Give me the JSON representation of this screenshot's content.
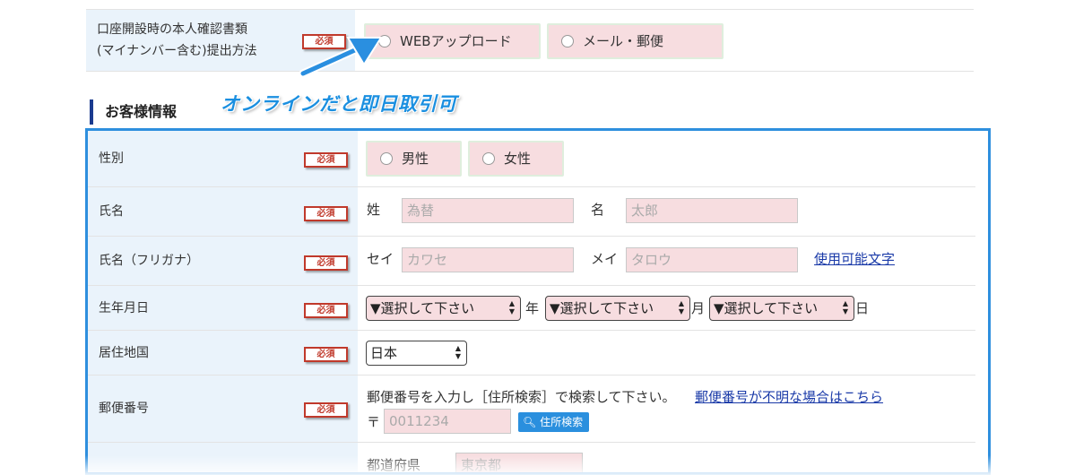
{
  "top_section": {
    "label_line1": "口座開設時の本人確認書類",
    "label_line2": "(マイナンバー含む)提出方法",
    "required": "必須",
    "options": [
      "WEBアップロード",
      "メール・郵便"
    ]
  },
  "customer_section": {
    "heading": "お客様情報",
    "annotation": "オンラインだと即日取引可"
  },
  "required_badge": "必須",
  "fields": {
    "gender": {
      "label": "性別",
      "options": [
        "男性",
        "女性"
      ]
    },
    "name": {
      "label": "氏名",
      "sei_label": "姓",
      "sei_placeholder": "為替",
      "mei_label": "名",
      "mei_placeholder": "太郎"
    },
    "kana": {
      "label": "氏名（フリガナ）",
      "sei_label": "セイ",
      "sei_placeholder": "カワセ",
      "mei_label": "メイ",
      "mei_placeholder": "タロウ",
      "help_link": "使用可能文字"
    },
    "birthdate": {
      "label": "生年月日",
      "select_default": "▼選択して下さい",
      "year_suffix": "年",
      "month_suffix": "月",
      "day_suffix": "日"
    },
    "country": {
      "label": "居住地国",
      "value": "日本"
    },
    "postal": {
      "label": "郵便番号",
      "instruction": "郵便番号を入力し［住所検索］で検索して下さい。",
      "unknown_link": "郵便番号が不明な場合はこちら",
      "mark": "〒",
      "placeholder": "0011234",
      "search_button": "住所検索"
    },
    "prefecture": {
      "label": "都道府県",
      "placeholder": "東京都"
    }
  },
  "colors": {
    "accent_blue": "#2e8fde",
    "required_red": "#c0392b",
    "field_pink": "#f7dde0",
    "label_bg": "#eaf3fb",
    "heading_bar": "#1b3b8f",
    "link_blue": "#1a3aa8"
  }
}
